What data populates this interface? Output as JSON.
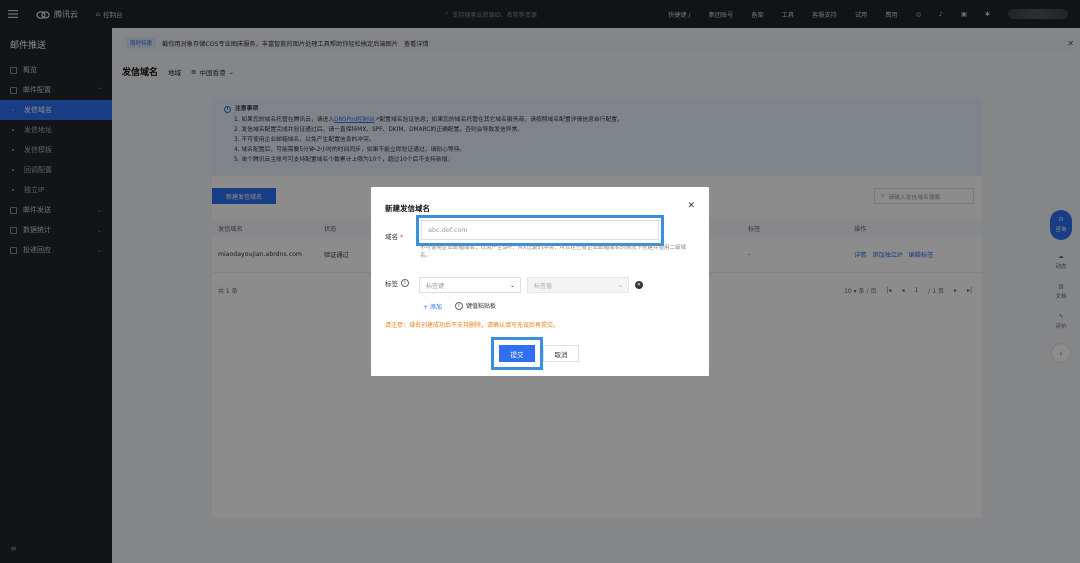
{
  "topbar": {
    "brand": "腾讯云",
    "console": "控制台",
    "search_placeholder": "支持搜索云资源ID、名称等资源",
    "nav": [
      "快捷键 /",
      "集团账号",
      "备案",
      "工具",
      "客服支持",
      "试用",
      "费用"
    ]
  },
  "sidebar": {
    "title": "邮件推送",
    "overview": "概览",
    "mail_config": "邮件配置",
    "sub_items": [
      "发信域名",
      "发信地址",
      "发信模板",
      "回调配置",
      "独立IP"
    ],
    "mail_send": "邮件发送",
    "data_stats": "数据统计",
    "delivery_rollback": "投递回应"
  },
  "notice": {
    "tag": "限时特惠",
    "text": "截你用对象存储COS专业图床服务，丰富智能的图片处理工具帮助你轻松搞定后端图片",
    "link": "查看详情"
  },
  "header": {
    "title": "发信域名",
    "region_label": "地域",
    "region_value": "中国香港"
  },
  "alert": {
    "title": "注意事项",
    "line1_pre": "1. 如果您的域名托管在腾讯云，请进入",
    "line1_link": "DNSPod控制台",
    "line1_post": "配置域名验证信息；如果您的域名托管在其它域名服务商，请按照域名配置详情信息自行配置。",
    "line2": "2. 发信域名配置完成并验证通过后，请一直保持MX、SPF、DKIM、DMARC的正确配置，否则会导致发信异常。",
    "line3": "3. 不可使用企业邮箱域名，以免产生配置信息的冲突。",
    "line4": "4. 域名配置后，可能需要5分钟-2小时的时间同步，如果不能立即验证通过，请耐心等待。",
    "line5": "5. 单个腾讯云主账号可支持配置域名个数累计上限为10个，超过10个后不支持新增。"
  },
  "toolbar": {
    "create_label": "新建发信域名",
    "search_placeholder": "请输入发信域名搜索"
  },
  "table": {
    "headers": [
      "发信域名",
      "状态",
      "标签",
      "操作"
    ],
    "rows": [
      {
        "domain": "miaodayoujian.abrdns.com",
        "status": "验证通过",
        "tag": "-",
        "ops": [
          "详情",
          "添加独立IP",
          "编辑标签"
        ]
      }
    ],
    "total": "共 1 条",
    "page_size": "10 ▾ 条 / 页",
    "page_num": "1",
    "page_total": "/ 1 页"
  },
  "float_tools": {
    "contact": "咨询",
    "items": [
      "动态",
      "文档",
      "评价"
    ]
  },
  "modal": {
    "title": "新建发信域名",
    "domain_label": "域名",
    "domain_placeholder": "abc.def.com",
    "domain_hint": "不可使用企业邮箱域名，以免产生SPF、MX记录的冲突，可以在已有企业邮箱域名的情况下创建并使用二级域名。",
    "tag_label": "标签",
    "tag_key_placeholder": "标签键",
    "tag_value_placeholder": "标签值",
    "add_label": "+ 添加",
    "paste_label": "键值粘贴板",
    "warning": "请注意：域名创建成功后不支持删除，请确认填写无误后再提交。",
    "submit_label": "提交",
    "cancel_label": "取消"
  }
}
